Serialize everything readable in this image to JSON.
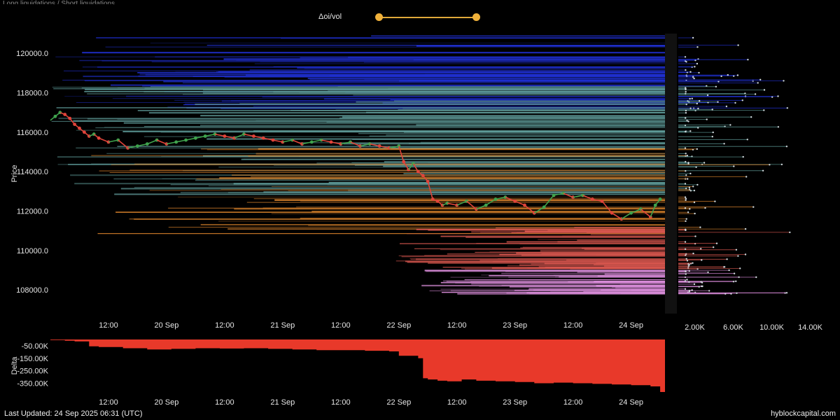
{
  "header": {
    "top_text": "Long liquidations / Short liquidations",
    "slider_label": "Δoi/vol"
  },
  "footer": {
    "last_updated": "Last Updated: 24 Sep 2025 06:31 (UTC)",
    "brand": "hyblockcapital.com"
  },
  "colors": {
    "background": "#000000",
    "price_up": "#3fa34d",
    "price_down": "#e0443a",
    "delta_fill": "#e8392a",
    "slider": "#f0b13a",
    "band_blue": "#1f2fd0",
    "band_teal": "#5e9a98",
    "band_orange": "#d9822b",
    "band_red": "#d9574f",
    "band_pink": "#d88bd8"
  },
  "chart_data": [
    {
      "type": "line",
      "panel": "price",
      "ylabel": "Price",
      "ylim": [
        106800,
        121000
      ],
      "yticks": [
        "120000.0",
        "118000.0",
        "116000.0",
        "114000.0",
        "112000.0",
        "110000.0",
        "108000.0"
      ],
      "ytick_values": [
        120000,
        118000,
        116000,
        114000,
        112000,
        110000,
        108000
      ],
      "xticks": [
        "12:00",
        "20 Sep",
        "12:00",
        "21 Sep",
        "12:00",
        "22 Sep",
        "12:00",
        "23 Sep",
        "12:00",
        "24 Sep"
      ],
      "xtick_hours": [
        12,
        24,
        36,
        48,
        60,
        72,
        84,
        96,
        108,
        120
      ],
      "xlim_hours": [
        0,
        127
      ],
      "x_start": "19 Sep 00:00 (UTC)",
      "series": [
        {
          "x_hours": [
            0,
            1,
            2,
            3,
            4,
            5,
            6,
            7,
            8,
            9,
            10,
            12,
            14,
            16,
            18,
            20,
            22,
            24,
            26,
            28,
            30,
            32,
            34,
            36,
            38,
            40,
            42,
            44,
            46,
            48,
            50,
            52,
            54,
            56,
            58,
            60,
            62,
            64,
            66,
            68,
            70,
            72,
            73,
            74,
            75,
            76,
            77,
            78,
            79,
            80,
            81,
            82,
            84,
            86,
            88,
            90,
            92,
            94,
            96,
            98,
            100,
            102,
            104,
            106,
            108,
            110,
            112,
            114,
            116,
            118,
            120,
            122,
            124,
            125,
            126
          ],
          "y": [
            116600,
            116800,
            117000,
            116900,
            116700,
            116400,
            116200,
            116000,
            115800,
            115900,
            115700,
            115500,
            115600,
            115200,
            115300,
            115400,
            115600,
            115400,
            115500,
            115600,
            115700,
            115800,
            115900,
            115800,
            115700,
            115900,
            115800,
            115700,
            115600,
            115500,
            115600,
            115400,
            115500,
            115600,
            115500,
            115400,
            115500,
            115300,
            115400,
            115300,
            115200,
            115300,
            114500,
            114100,
            114400,
            114000,
            113800,
            113500,
            112600,
            112500,
            112300,
            112400,
            112300,
            112500,
            112100,
            112300,
            112600,
            112700,
            112500,
            112300,
            111900,
            112200,
            112800,
            112900,
            112700,
            112800,
            112600,
            112500,
            111900,
            111600,
            111900,
            112100,
            111700,
            112300,
            112600
          ]
        }
      ]
    },
    {
      "type": "area",
      "panel": "delta",
      "ylabel": "Delta",
      "ylim": [
        -420000,
        0
      ],
      "yticks": [
        "-50.00K",
        "-150.00K",
        "-250.00K",
        "-350.00K"
      ],
      "ytick_values": [
        -50000,
        -150000,
        -250000,
        -350000
      ],
      "xticks": [
        "12:00",
        "20 Sep",
        "12:00",
        "21 Sep",
        "12:00",
        "22 Sep",
        "12:00",
        "23 Sep",
        "12:00",
        "24 Sep"
      ],
      "xtick_hours": [
        12,
        24,
        36,
        48,
        60,
        72,
        84,
        96,
        108,
        120
      ],
      "series": [
        {
          "x_hours": [
            0,
            3,
            5,
            8,
            10,
            15,
            20,
            25,
            30,
            35,
            40,
            45,
            50,
            55,
            60,
            65,
            70,
            72,
            76,
            77,
            78,
            80,
            82,
            85,
            88,
            92,
            96,
            100,
            104,
            108,
            112,
            116,
            120,
            124,
            126,
            127
          ],
          "values": [
            -5000,
            -10000,
            -15000,
            -55000,
            -60000,
            -70000,
            -80000,
            -75000,
            -70000,
            -72000,
            -70000,
            -75000,
            -80000,
            -85000,
            -85000,
            -90000,
            -95000,
            -130000,
            -150000,
            -310000,
            -320000,
            -330000,
            -335000,
            -320000,
            -330000,
            -335000,
            -340000,
            -350000,
            -345000,
            -350000,
            -355000,
            -360000,
            -365000,
            -375000,
            -420000,
            -400000
          ]
        }
      ]
    },
    {
      "type": "bar",
      "panel": "liquidation_profile",
      "xticks": [
        "2.00K",
        "6.00K",
        "10.00K",
        "14.00K"
      ],
      "xtick_values": [
        2000,
        6000,
        10000,
        14000
      ],
      "xlim": [
        0,
        16000
      ]
    }
  ]
}
